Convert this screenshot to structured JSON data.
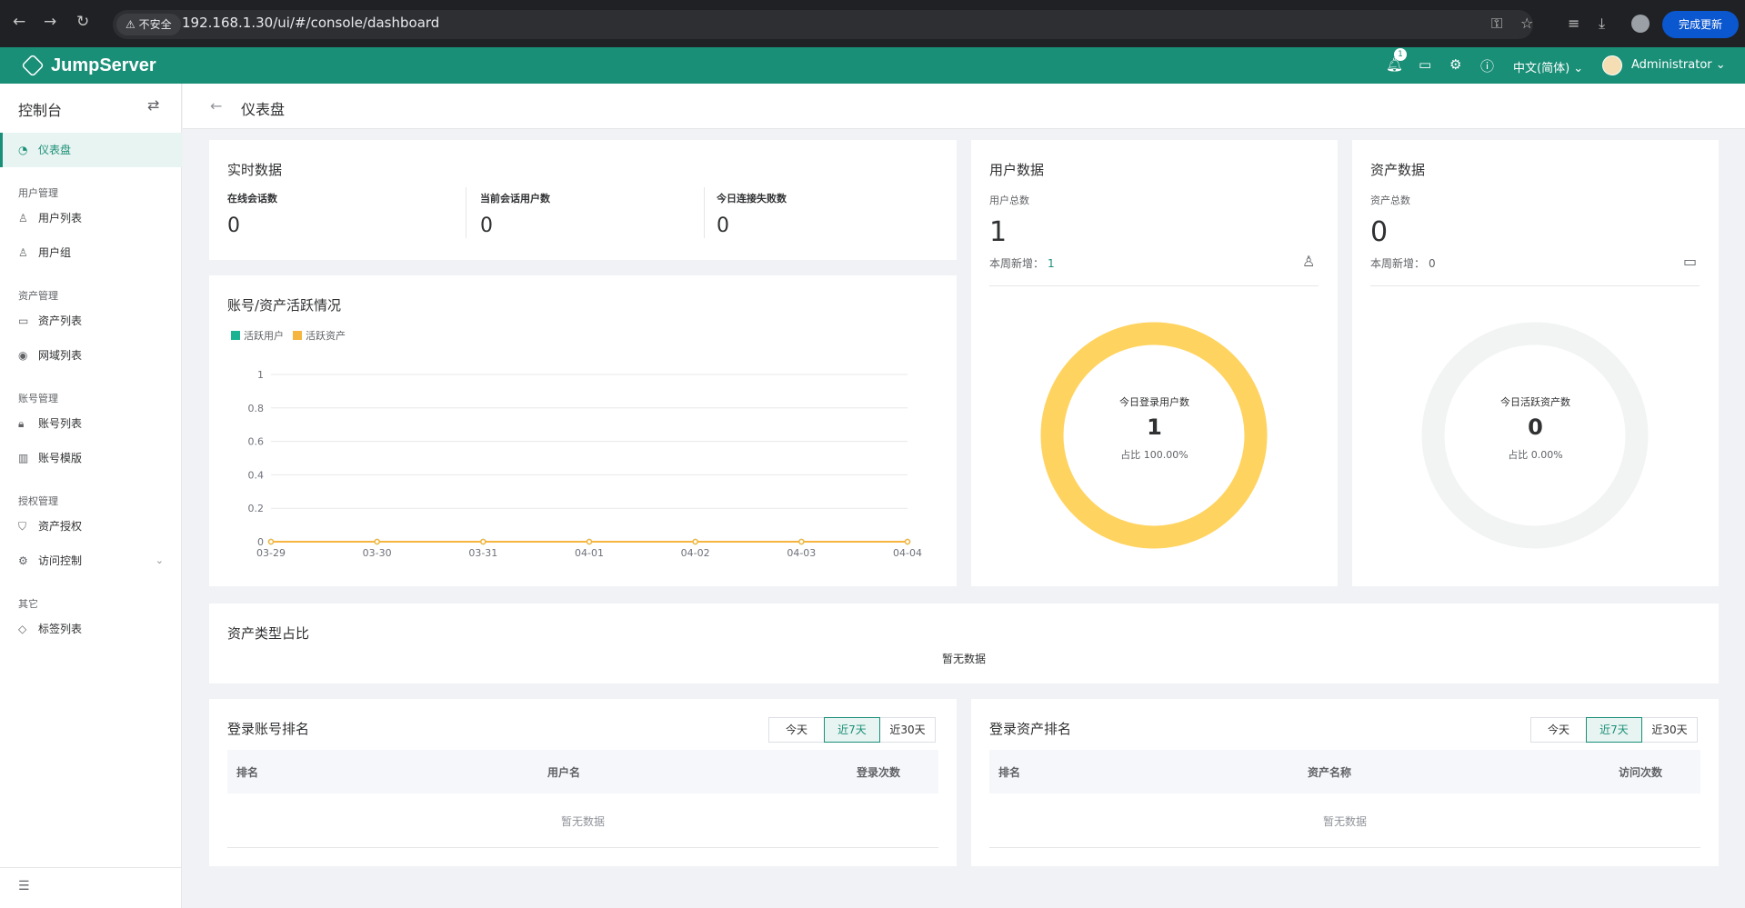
{
  "browser": {
    "security_label": "不安全",
    "url": "192.168.1.30/ui/#/console/dashboard",
    "update_label": "完成更新"
  },
  "header": {
    "brand": "JumpServer",
    "notification_count": "1",
    "language": "中文(简体)",
    "username": "Administrator"
  },
  "sidebar": {
    "title": "控制台",
    "active_item": "仪表盘",
    "groups": {
      "users": "用户管理",
      "assets": "资产管理",
      "accounts": "账号管理",
      "perms": "授权管理",
      "other": "其它"
    },
    "items": {
      "user_list": "用户列表",
      "user_group": "用户组",
      "asset_list": "资产列表",
      "domain_list": "网域列表",
      "account_list": "账号列表",
      "account_template": "账号模版",
      "asset_perm": "资产授权",
      "access_control": "访问控制",
      "label_list": "标签列表"
    }
  },
  "breadcrumb": {
    "title": "仪表盘"
  },
  "realtime": {
    "title": "实时数据",
    "online_sessions_label": "在线会话数",
    "online_sessions": "0",
    "session_users_label": "当前会话用户数",
    "session_users": "0",
    "failed_today_label": "今日连接失败数",
    "failed_today": "0"
  },
  "activity": {
    "title": "账号/资产活跃情况",
    "legend_users": "活跃用户",
    "legend_assets": "活跃资产"
  },
  "user_stats": {
    "title": "用户数据",
    "total_label": "用户总数",
    "total": "1",
    "new_label": "本周新增：",
    "new": "1",
    "donut_label": "今日登录用户数",
    "donut_value": "1",
    "donut_percent": "占比 100.00%"
  },
  "asset_stats": {
    "title": "资产数据",
    "total_label": "资产总数",
    "total": "0",
    "new_label": "本周新增：",
    "new": "0",
    "donut_label": "今日活跃资产数",
    "donut_value": "0",
    "donut_percent": "占比 0.00%"
  },
  "asset_types": {
    "title": "资产类型占比",
    "empty": "暂无数据"
  },
  "login_account_rank": {
    "title": "登录账号排名",
    "tabs": [
      "今天",
      "近7天",
      "近30天"
    ],
    "active_tab": "近7天",
    "columns": [
      "排名",
      "用户名",
      "登录次数"
    ],
    "empty": "暂无数据"
  },
  "login_asset_rank": {
    "title": "登录资产排名",
    "tabs": [
      "今天",
      "近7天",
      "近30天"
    ],
    "active_tab": "近7天",
    "columns": [
      "排名",
      "资产名称",
      "访问次数"
    ],
    "empty": "暂无数据"
  },
  "colors": {
    "brand": "#1a8f78",
    "active_users": "#19b394",
    "active_assets": "#f5b53f",
    "donut_user": "#ffd35f",
    "donut_empty": "#f2f4f3"
  },
  "chart_data": {
    "type": "line",
    "title": "账号/资产活跃情况",
    "x": [
      "03-29",
      "03-30",
      "03-31",
      "04-01",
      "04-02",
      "04-03",
      "04-04"
    ],
    "series": [
      {
        "name": "活跃用户",
        "values": [
          0,
          0,
          0,
          0,
          0,
          0,
          0
        ]
      },
      {
        "name": "活跃资产",
        "values": [
          0,
          0,
          0,
          0,
          0,
          0,
          0
        ]
      }
    ],
    "yticks": [
      "0",
      "0.2",
      "0.4",
      "0.6",
      "0.8",
      "1"
    ],
    "ylim": [
      0,
      1
    ],
    "grid": true,
    "legend": "top-left"
  }
}
